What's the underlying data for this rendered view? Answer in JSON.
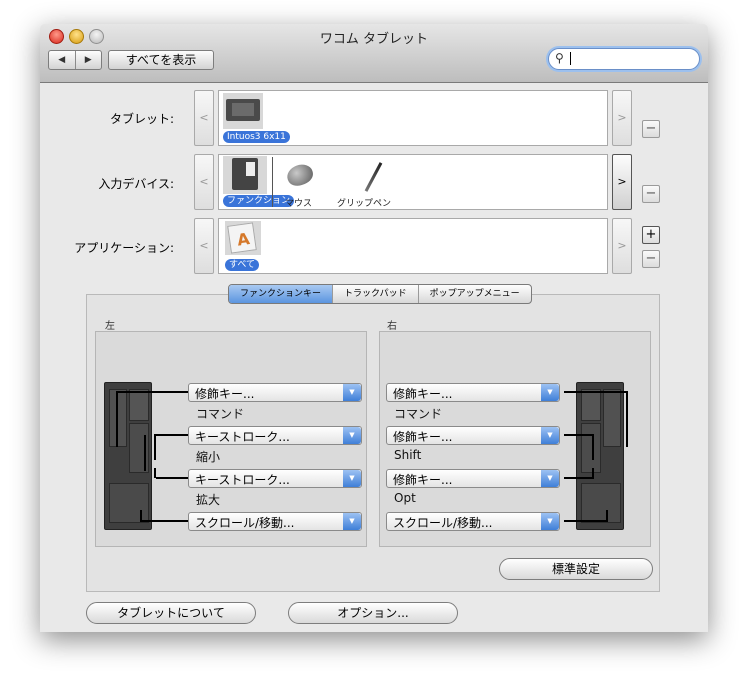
{
  "window": {
    "title": "ワコム タブレット"
  },
  "toolbar": {
    "back_icon": "◀",
    "forward_icon": "▶",
    "show_all": "すべてを表示",
    "search_value": ""
  },
  "rows": {
    "tablet": {
      "label": "タブレット:",
      "item_label": "Intuos3 6x11"
    },
    "input_device": {
      "label": "入力デバイス:",
      "items": [
        "ファンクション",
        "マウス",
        "グリップペン"
      ]
    },
    "application": {
      "label": "アプリケーション:",
      "item_label": "すべて"
    }
  },
  "buttons": {
    "left_arrow": "<",
    "right_arrow": ">",
    "minus": "−",
    "plus": "+"
  },
  "tabs": [
    "ファンクションキー",
    "トラックパッド",
    "ポップアップメニュー"
  ],
  "left": {
    "title": "左",
    "keys": [
      {
        "popup": "修飾キー...",
        "sub": "コマンド"
      },
      {
        "popup": "キーストローク...",
        "sub": "縮小"
      },
      {
        "popup": "キーストローク...",
        "sub": "拡大"
      },
      {
        "popup": "スクロール/移動...",
        "sub": ""
      }
    ]
  },
  "right": {
    "title": "右",
    "keys": [
      {
        "popup": "修飾キー...",
        "sub": "コマンド"
      },
      {
        "popup": "修飾キー...",
        "sub": "Shift"
      },
      {
        "popup": "修飾キー...",
        "sub": "Opt"
      },
      {
        "popup": "スクロール/移動...",
        "sub": ""
      }
    ]
  },
  "defaults_button": "標準設定",
  "bottom": {
    "about_tablet": "タブレットについて",
    "options": "オプション..."
  }
}
